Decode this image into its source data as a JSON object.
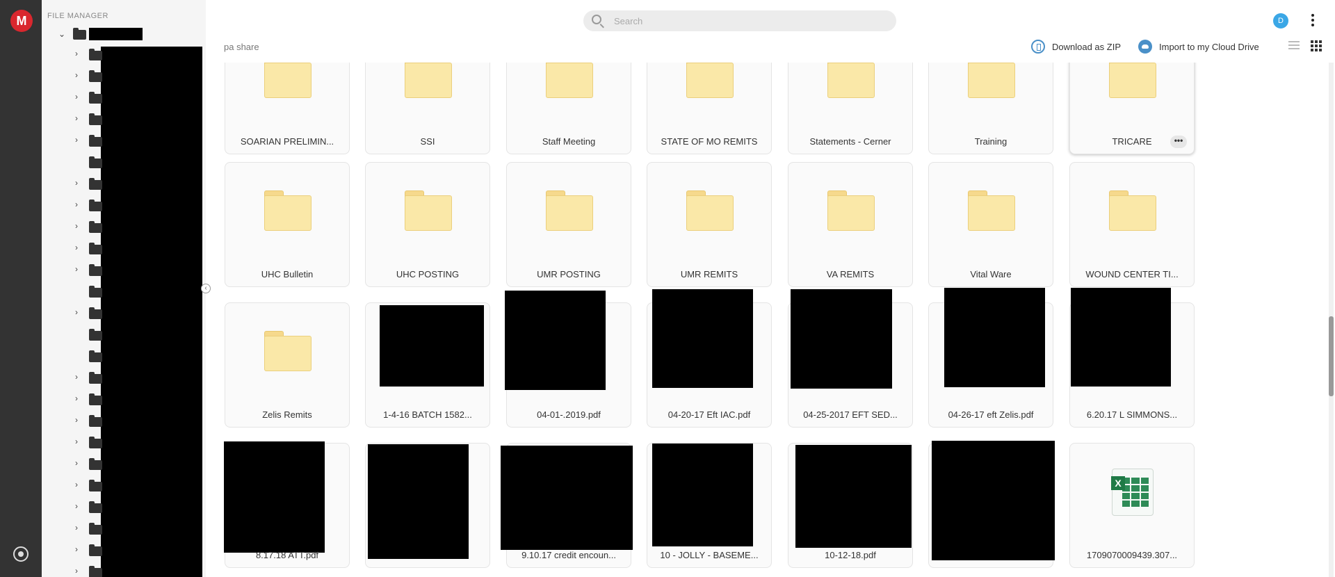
{
  "app": {
    "logo_letter": "M",
    "tree_header": "FILE MANAGER"
  },
  "search": {
    "placeholder": "Search",
    "value": ""
  },
  "user": {
    "avatar_letter": "D",
    "avatar_color": "#3ba7e6"
  },
  "breadcrumb": "pa share",
  "actions": {
    "download_zip": "Download as ZIP",
    "import_cloud": "Import to my Cloud Drive"
  },
  "colors": {
    "rail": "#333333",
    "accent_red": "#d9272e",
    "folder_yellow": "#fae8a8",
    "action_blue": "#4a90c8"
  },
  "rows": [
    {
      "cards": [
        {
          "type": "folder",
          "name": "SOARIAN PRELIMIN..."
        },
        {
          "type": "folder",
          "name": "SSI"
        },
        {
          "type": "folder",
          "name": "Staff Meeting"
        },
        {
          "type": "folder",
          "name": "STATE OF MO REMITS"
        },
        {
          "type": "folder",
          "name": "Statements - Cerner"
        },
        {
          "type": "folder",
          "name": "Training"
        },
        {
          "type": "folder",
          "name": "TRICARE",
          "hover": true
        }
      ]
    },
    {
      "cards": [
        {
          "type": "folder",
          "name": "UHC Bulletin"
        },
        {
          "type": "folder",
          "name": "UHC POSTING"
        },
        {
          "type": "folder",
          "name": "UMR POSTING"
        },
        {
          "type": "folder",
          "name": "UMR REMITS"
        },
        {
          "type": "folder",
          "name": "VA REMITS"
        },
        {
          "type": "folder",
          "name": "Vital Ware"
        },
        {
          "type": "folder",
          "name": "WOUND CENTER TI..."
        }
      ]
    },
    {
      "cards": [
        {
          "type": "folder",
          "name": "Zelis Remits"
        },
        {
          "type": "file",
          "name": "1-4-16 BATCH 1582..."
        },
        {
          "type": "file",
          "name": "04-01-.2019.pdf"
        },
        {
          "type": "file",
          "name": "04-20-17 Eft IAC.pdf"
        },
        {
          "type": "file",
          "name": "04-25-2017 EFT SED..."
        },
        {
          "type": "file",
          "name": "04-26-17 eft Zelis.pdf"
        },
        {
          "type": "file",
          "name": "6.20.17 L SIMMONS..."
        }
      ]
    },
    {
      "cards": [
        {
          "type": "file",
          "name": "8.17.18 ATT.pdf"
        },
        {
          "type": "file",
          "name": ""
        },
        {
          "type": "file",
          "name": "9.10.17 credit encoun..."
        },
        {
          "type": "file",
          "name": "10 - JOLLY - BASEME..."
        },
        {
          "type": "file",
          "name": "10-12-18.pdf"
        },
        {
          "type": "file",
          "name": ""
        },
        {
          "type": "xlsx",
          "name": "1709070009439.307..."
        }
      ]
    }
  ]
}
